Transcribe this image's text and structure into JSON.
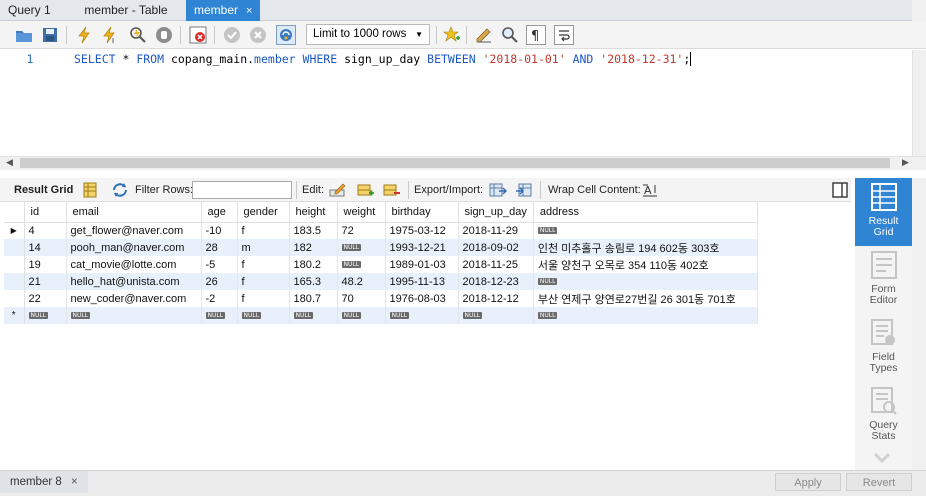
{
  "tabs": [
    {
      "label": "Query 1"
    },
    {
      "label": "member - Table"
    },
    {
      "label": "member",
      "close": "×"
    }
  ],
  "toolbar": {
    "limit_label": "Limit to 1000 rows"
  },
  "editor": {
    "line_number": "1",
    "sql": {
      "select": "SELECT",
      "star": " * ",
      "from": "FROM",
      "schema": " copang_main.",
      "table": "member",
      "where": " WHERE",
      "column": " sign_up_day ",
      "between": "BETWEEN",
      "d1": " '2018-01-01' ",
      "and": "AND",
      "d2": " '2018-12-31'",
      "semi": ";"
    }
  },
  "result_toolbar": {
    "result_grid": "Result Grid",
    "filter_rows": "Filter Rows:",
    "edit": "Edit:",
    "export_import": "Export/Import:",
    "wrap_cell": "Wrap Cell Content:"
  },
  "grid": {
    "columns": [
      "id",
      "email",
      "age",
      "gender",
      "height",
      "weight",
      "birthday",
      "sign_up_day",
      "address"
    ],
    "null_text": "NULL",
    "new_row_marker": "*",
    "rows": [
      {
        "id": "4",
        "email": "get_flower@naver.com",
        "age": "-10",
        "gender": "f",
        "height": "183.5",
        "weight": "72",
        "birthday": "1975-03-12",
        "sign_up_day": "2018-11-29",
        "address": null
      },
      {
        "id": "14",
        "email": "pooh_man@naver.com",
        "age": "28",
        "gender": "m",
        "height": "182",
        "weight": null,
        "birthday": "1993-12-21",
        "sign_up_day": "2018-09-02",
        "address": "인천 미추홀구 송림로 194 602동 303호"
      },
      {
        "id": "19",
        "email": "cat_movie@lotte.com",
        "age": "-5",
        "gender": "f",
        "height": "180.2",
        "weight": null,
        "birthday": "1989-01-03",
        "sign_up_day": "2018-11-25",
        "address": "서울 양천구 오목로 354 110동 402호"
      },
      {
        "id": "21",
        "email": "hello_hat@unista.com",
        "age": "26",
        "gender": "f",
        "height": "165.3",
        "weight": "48.2",
        "birthday": "1995-11-13",
        "sign_up_day": "2018-12-23",
        "address": null
      },
      {
        "id": "22",
        "email": "new_coder@naver.com",
        "age": "-2",
        "gender": "f",
        "height": "180.7",
        "weight": "70",
        "birthday": "1976-08-03",
        "sign_up_day": "2018-12-12",
        "address": "부산 연제구 양연로27번길 26 301동 701호"
      }
    ]
  },
  "side_panel": [
    {
      "label1": "Result",
      "label2": "Grid",
      "icon": "result-grid-icon",
      "active": true
    },
    {
      "label1": "Form",
      "label2": "Editor",
      "icon": "form-editor-icon",
      "active": false
    },
    {
      "label1": "Field",
      "label2": "Types",
      "icon": "field-types-icon",
      "active": false
    },
    {
      "label1": "Query",
      "label2": "Stats",
      "icon": "query-stats-icon",
      "active": false
    }
  ],
  "bottom": {
    "tab_label": "member 8",
    "close": "×",
    "apply": "Apply",
    "revert": "Revert"
  },
  "colors": {
    "accent": "#2f84d3",
    "keyword": "#1b58c4",
    "string": "#c0392b",
    "alt_row": "#e8f1fb"
  }
}
